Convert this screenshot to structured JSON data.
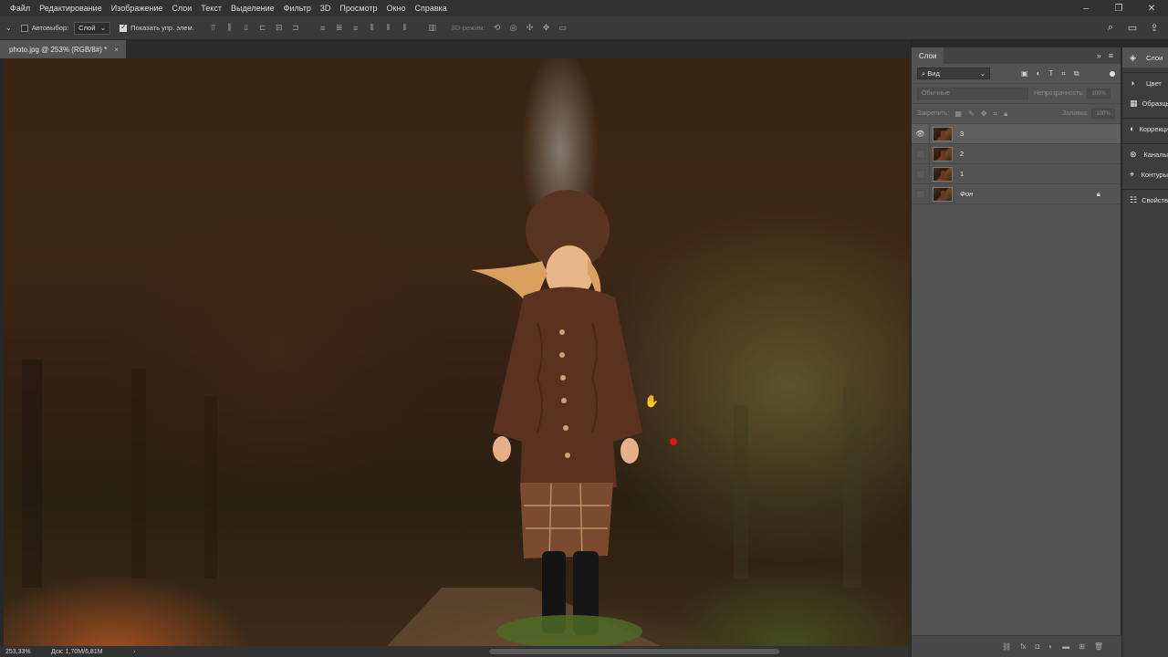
{
  "menu": {
    "items": [
      "Файл",
      "Редактирование",
      "Изображение",
      "Слои",
      "Текст",
      "Выделение",
      "Фильтр",
      "3D",
      "Просмотр",
      "Окно",
      "Справка"
    ]
  },
  "options": {
    "tool_dropdown": "⌄",
    "autoselect_label": "Автовыбор:",
    "autoselect_value": "Слой",
    "show_transform_label": "Показать упр. элем.",
    "mode_3d_label": "3D-режим:"
  },
  "document": {
    "tab_label": "photo.jpg @ 253% (RGB/8#) *",
    "close_glyph": "×"
  },
  "status": {
    "zoom": "253,33%",
    "doc_info": "Док: 1,70M/6,81M",
    "arrow": "›"
  },
  "layers_panel": {
    "title": "Слои",
    "filter_label": "Вид",
    "blend_mode": "Обычные",
    "opacity_label": "Непрозрачность:",
    "opacity_value": "100%",
    "lock_label": "Закрепить:",
    "fill_label": "Заливка:",
    "fill_value": "100%",
    "layers": [
      {
        "name": "3",
        "visible": true
      },
      {
        "name": "2",
        "visible": false
      },
      {
        "name": "1",
        "visible": false
      },
      {
        "name": "Фон",
        "visible": false,
        "locked": true
      }
    ]
  },
  "dock": {
    "items": [
      "Слои",
      "Цвет",
      "Образцы",
      "Коррекция",
      "Каналы",
      "Контуры",
      "Свойства"
    ]
  }
}
